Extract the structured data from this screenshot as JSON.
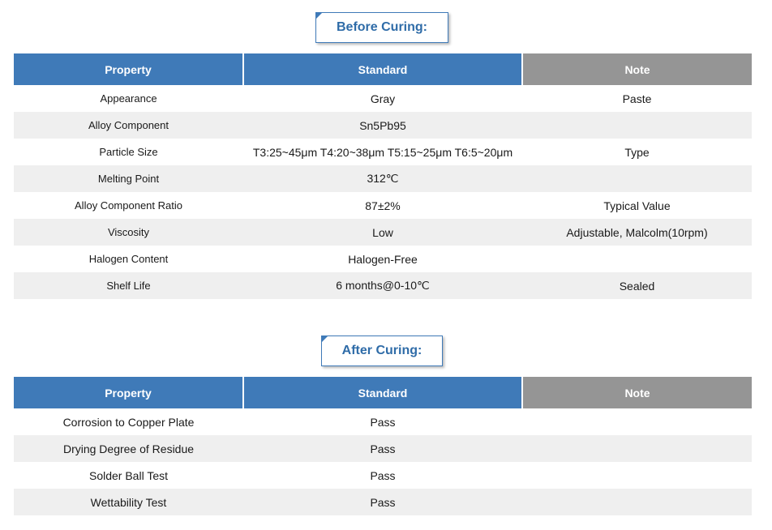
{
  "before": {
    "title": "Before Curing:",
    "headers": {
      "property": "Property",
      "standard": "Standard",
      "note": "Note"
    },
    "rows": [
      {
        "property": "Appearance",
        "standard": "Gray",
        "note": "Paste"
      },
      {
        "property": "Alloy Component",
        "standard": "Sn5Pb95",
        "note": ""
      },
      {
        "property": "Particle Size",
        "standard": "T3:25~45μm T4:20~38μm T5:15~25μm T6:5~20μm",
        "note": "Type"
      },
      {
        "property": "Melting Point",
        "standard": "312℃",
        "note": ""
      },
      {
        "property": "Alloy Component Ratio",
        "standard": "87±2%",
        "note": "Typical Value"
      },
      {
        "property": "Viscosity",
        "standard": "Low",
        "note": "Adjustable, Malcolm(10rpm)"
      },
      {
        "property": "Halogen Content",
        "standard": "Halogen-Free",
        "note": ""
      },
      {
        "property": "Shelf Life",
        "standard": "6 months@0-10℃",
        "note": "Sealed"
      }
    ]
  },
  "after": {
    "title": "After Curing:",
    "headers": {
      "property": "Property",
      "standard": "Standard",
      "note": "Note"
    },
    "rows": [
      {
        "property": "Corrosion to Copper Plate",
        "standard": "Pass",
        "note": ""
      },
      {
        "property": "Drying Degree of Residue",
        "standard": "Pass",
        "note": ""
      },
      {
        "property": "Solder Ball Test",
        "standard": "Pass",
        "note": ""
      },
      {
        "property": "Wettability Test",
        "standard": "Pass",
        "note": ""
      }
    ]
  },
  "colors": {
    "header_blue": "#3f7ab8",
    "header_gray": "#959595",
    "row_alt": "#efefef",
    "title_text": "#2f6ca8"
  }
}
